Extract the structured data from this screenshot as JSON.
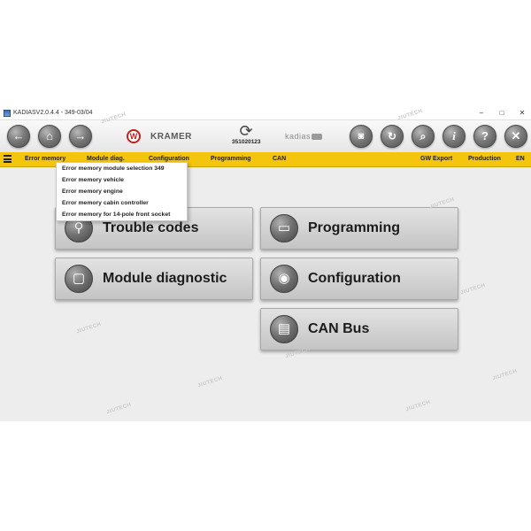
{
  "window": {
    "title": "KADIASV2.0.4.4 - 349-03/04",
    "controls": {
      "minimize": "–",
      "maximize": "□",
      "close": "✕"
    }
  },
  "toolbar": {
    "nav_icons": [
      "back-arrow-icon",
      "home-icon",
      "forward-arrow-icon"
    ],
    "brand_logo": "W",
    "brand_name": "KRAMER",
    "sync_number": "351020123",
    "product_logo": "kadias",
    "action_icons": [
      "camera-icon",
      "refresh-icon",
      "search-icon",
      "info-icon",
      "help-icon",
      "close-icon"
    ]
  },
  "menubar": {
    "items": {
      "error_memory": "Error memory",
      "module_diag": "Module diag.",
      "configuration": "Configuration",
      "programming": "Programming",
      "can": "CAN",
      "gw_export": "GW Export",
      "production": "Production",
      "language": "EN"
    },
    "accent_color": "#f4c50d"
  },
  "dropdown": {
    "items": [
      "Error memory module selection 349",
      "Error memory vehicle",
      "Error memory engine",
      "Error memory cabin controller",
      "Error memory for 14-pole front socket"
    ]
  },
  "main": {
    "buttons": [
      {
        "label": "Trouble codes",
        "icon": "magnifier-icon"
      },
      {
        "label": "Programming",
        "icon": "laptop-icon"
      },
      {
        "label": "Module diagnostic",
        "icon": "module-icon"
      },
      {
        "label": "Configuration",
        "icon": "eye-icon"
      },
      {
        "label": "CAN Bus",
        "icon": "document-icon"
      }
    ]
  },
  "watermark": "JIUTECH"
}
